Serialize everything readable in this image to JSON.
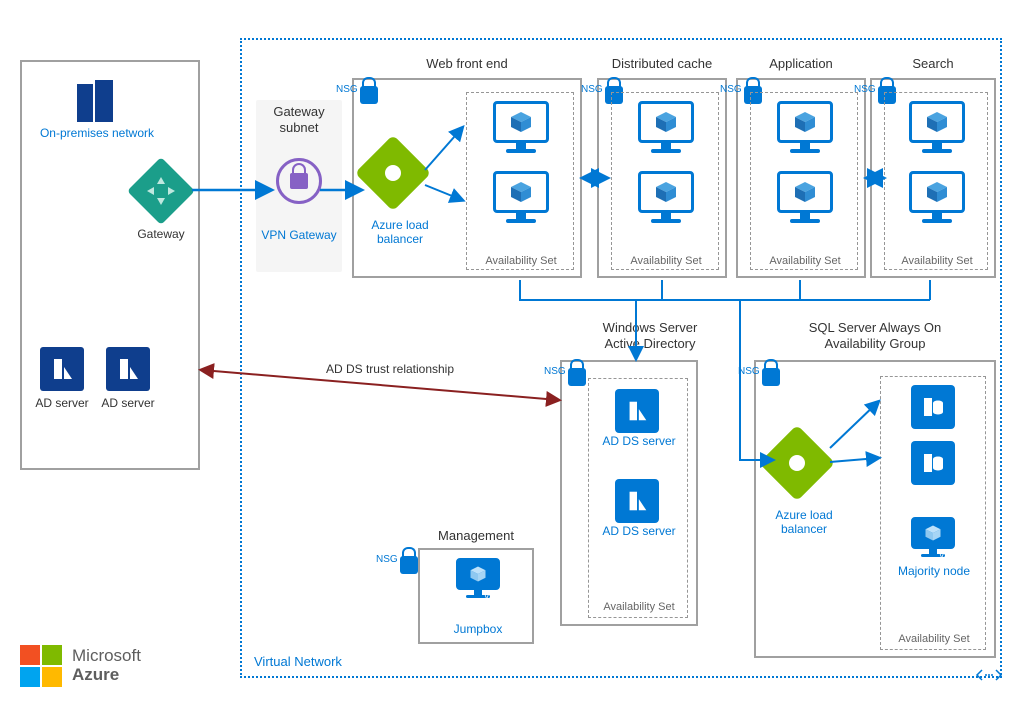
{
  "onprem": {
    "title": "On-premises network",
    "gateway_label": "Gateway",
    "ad_server_label": "AD server"
  },
  "vnet": {
    "label": "Virtual Network",
    "gateway_subnet": {
      "title": "Gateway subnet",
      "vpn_label": "VPN Gateway"
    },
    "tiers": {
      "web": {
        "title": "Web front end",
        "lb_label": "Azure load balancer",
        "avset": "Availability Set",
        "nsg": "NSG"
      },
      "cache": {
        "title": "Distributed cache",
        "avset": "Availability Set",
        "nsg": "NSG"
      },
      "app": {
        "title": "Application",
        "avset": "Availability Set",
        "nsg": "NSG"
      },
      "search": {
        "title": "Search",
        "avset": "Availability Set",
        "nsg": "NSG"
      }
    },
    "addirectory": {
      "title_l1": "Windows Server",
      "title_l2": "Active Directory",
      "server_label": "AD DS server",
      "avset": "Availability Set",
      "nsg": "NSG"
    },
    "sql": {
      "title_l1": "SQL Server Always On",
      "title_l2": "Availability Group",
      "lb_label": "Azure load balancer",
      "majority_label": "Majority node",
      "avset": "Availability Set",
      "nsg": "NSG",
      "vm_tag": "VM"
    },
    "management": {
      "title": "Management",
      "jumpbox_label": "Jumpbox",
      "vm_tag": "VM",
      "nsg": "NSG"
    }
  },
  "arrows": {
    "trust": "AD DS trust relationship"
  },
  "branding": {
    "line1": "Microsoft",
    "line2": "Azure"
  },
  "colors": {
    "azure_blue": "#0078d4",
    "dark_blue": "#0f3e8d",
    "green": "#7fba00",
    "teal": "#1b9e8a",
    "purple": "#8661c5",
    "ms_red": "#f25022",
    "ms_green": "#7fba00",
    "ms_blue": "#00a4ef",
    "ms_yellow": "#ffb900"
  }
}
